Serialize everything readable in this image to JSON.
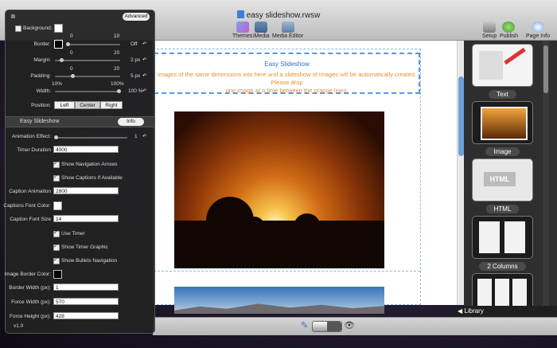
{
  "window": {
    "title": "easy slideshow.rwsw"
  },
  "toolbar": {
    "themes": "Themes",
    "imedia": "iMedia",
    "media_editor": "Media Editor",
    "setup": "Setup",
    "publish": "Publish",
    "page_info": "Page Info"
  },
  "page": {
    "banner_title": "Easy Slideshow",
    "banner_text_line1": "images of the same dimensions into here and a slideshow of images will be automatically created. Please drop",
    "banner_text_line2": "one image at a time between the orange lines."
  },
  "library": {
    "items": [
      {
        "label": "Text"
      },
      {
        "label": "Image"
      },
      {
        "label": "HTML"
      },
      {
        "label": "2 Columns"
      }
    ],
    "footer_label": "Library",
    "html_thumb_text": "HTML"
  },
  "inspector": {
    "advanced_button": "Advanced",
    "background_label": "Background:",
    "border_label": "Border:",
    "border_scale_min": "0",
    "border_scale_max": "10",
    "border_value": "Off",
    "margin_label": "Margin:",
    "margin_scale_min": "0",
    "margin_scale_max": "20",
    "margin_value": "2 px",
    "padding_label": "Padding:",
    "padding_scale_min": "0",
    "padding_scale_max": "20",
    "padding_value": "5 px",
    "width_label": "Width:",
    "width_scale_min": "10%",
    "width_scale_max": "100%",
    "width_value": "100 %",
    "position_label": "Position:",
    "position_options": [
      "Left",
      "Center",
      "Right"
    ],
    "plugin_section": "Easy Slideshow",
    "info_button": "Info",
    "animation_effect_label": "Animation Effect:",
    "animation_effect_value": "1",
    "timer_duration_label": "Timer Duration",
    "timer_duration_value": "4000",
    "show_nav_arrows": "Show Navigation Arrows",
    "show_captions": "Show Captions If Available",
    "caption_animation_label": "Caption Animation",
    "caption_animation_value": "2800",
    "captions_font_color_label": "Captions Font Color:",
    "caption_font_size_label": "Caption Font Size",
    "caption_font_size_value": "14",
    "use_timer": "Use Timer",
    "show_timer_graphic": "Show Timer Graphic",
    "show_bullets": "Show Bullets Navigation",
    "image_border_color_label": "Image Border Color:",
    "border_width_label": "Border Width (px):",
    "border_width_value": "1",
    "force_width_label": "Force Width (px):",
    "force_width_value": "570",
    "force_height_label": "Force Height (px):",
    "force_height_value": "428",
    "version": "v1.0"
  },
  "colors": {
    "accent_blue": "#2f72c9",
    "banner_orange": "#e6922e",
    "panel_bg": "#222222"
  }
}
